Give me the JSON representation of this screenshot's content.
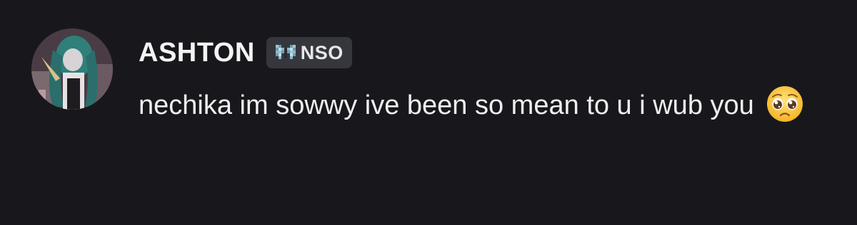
{
  "message": {
    "author": "ASHTON",
    "tag": {
      "icon": "butterfly-icon",
      "label": "NSO"
    },
    "text": "nechika im sowwy ive been so mean to u i wub you",
    "emoji": "pleading-face-emoji"
  },
  "colors": {
    "background": "#18181c",
    "text": "#eeeff1",
    "tag_background": "#36373d",
    "butterfly": "#8fb8c8"
  }
}
